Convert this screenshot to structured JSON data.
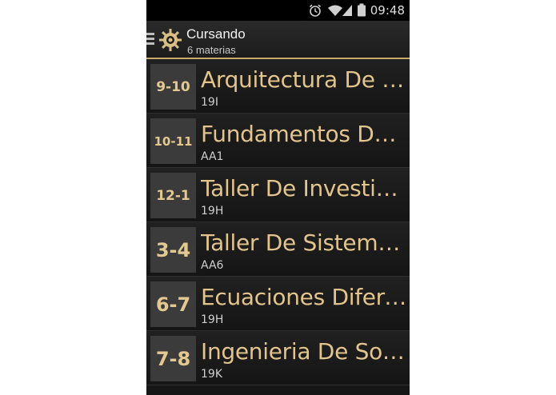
{
  "status_bar": {
    "time": "09:48",
    "icons": [
      "alarm-icon",
      "wifi-icon",
      "signal-icon",
      "battery-icon"
    ]
  },
  "action_bar": {
    "title": "Cursando",
    "subtitle": "6 materias",
    "accent_color": "#c9a86a"
  },
  "courses": [
    {
      "hours": "9-10",
      "name": "Arquitectura De C...",
      "room": "19I"
    },
    {
      "hours": "10-11",
      "name": "Fundamentos De...",
      "room": "AA1"
    },
    {
      "hours": "12-1",
      "name": "Taller De Investiga...",
      "room": "19H"
    },
    {
      "hours": "3-4",
      "name": "Taller De Sistema...",
      "room": "AA6"
    },
    {
      "hours": "6-7",
      "name": "Ecuaciones Difere...",
      "room": "19H"
    },
    {
      "hours": "7-8",
      "name": "Ingenieria De Soft...",
      "room": "19K"
    }
  ]
}
